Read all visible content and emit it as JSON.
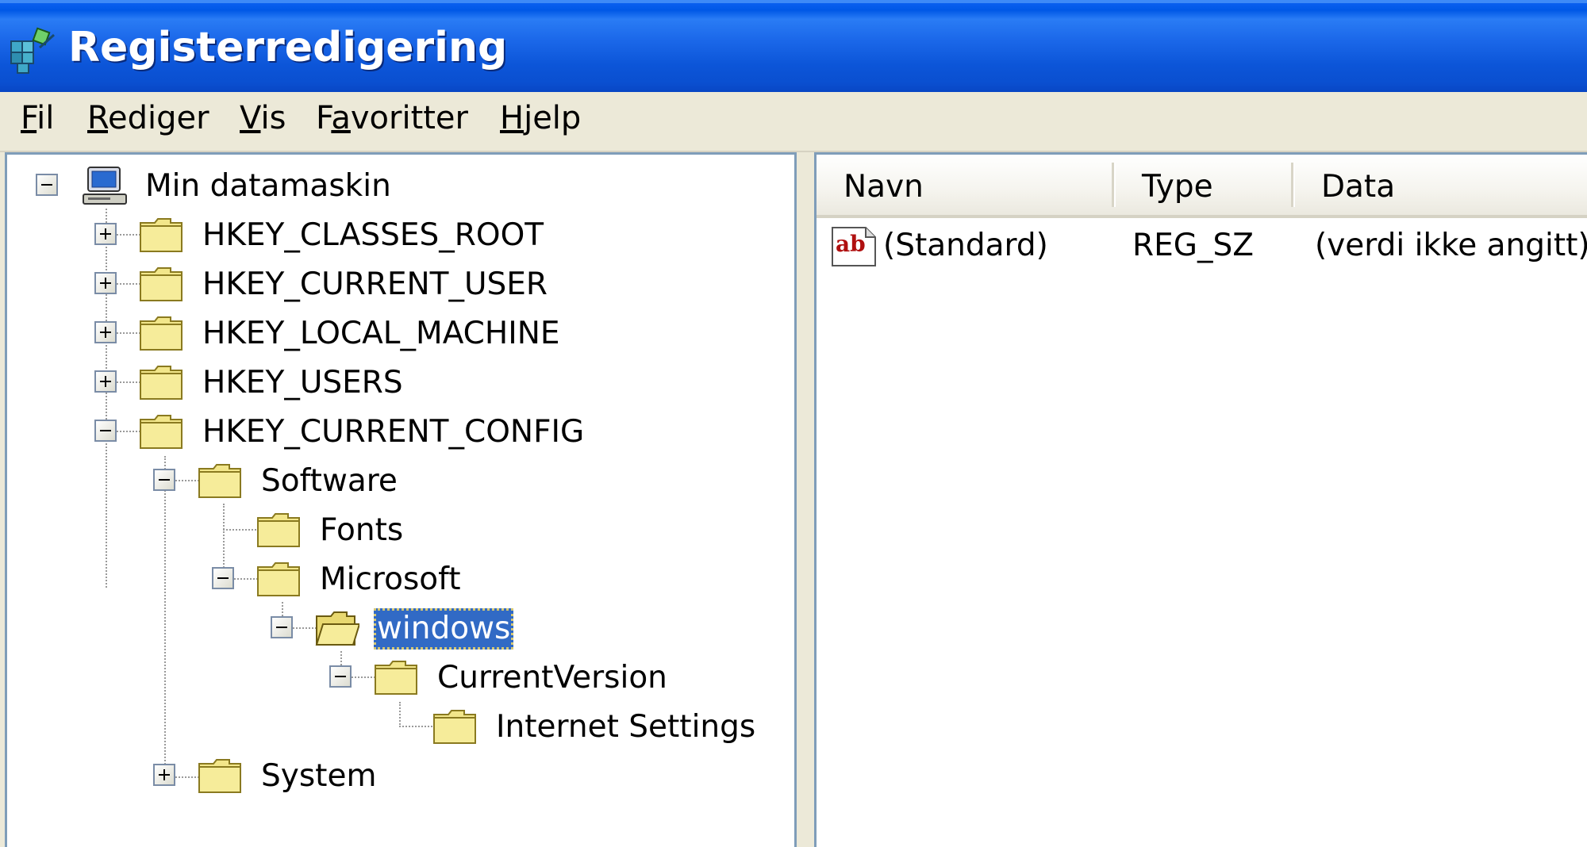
{
  "window": {
    "title": "Registerredigering"
  },
  "menu": [
    {
      "pre": "",
      "u": "F",
      "post": "il"
    },
    {
      "pre": "",
      "u": "R",
      "post": "ediger"
    },
    {
      "pre": "",
      "u": "V",
      "post": "is"
    },
    {
      "pre": "F",
      "u": "a",
      "post": "voritter"
    },
    {
      "pre": "",
      "u": "H",
      "post": "jelp"
    }
  ],
  "tree": {
    "root": "Min datamaskin",
    "hives": [
      "HKEY_CLASSES_ROOT",
      "HKEY_CURRENT_USER",
      "HKEY_LOCAL_MACHINE",
      "HKEY_USERS",
      "HKEY_CURRENT_CONFIG"
    ],
    "software": "Software",
    "fonts": "Fonts",
    "microsoft": "Microsoft",
    "windows": "windows",
    "current_version": "CurrentVersion",
    "internet_settings": "Internet Settings",
    "system": "System"
  },
  "list": {
    "columns": [
      "Navn",
      "Type",
      "Data"
    ],
    "rows": [
      {
        "name": "(Standard)",
        "type": "REG_SZ",
        "data": "(verdi ikke angitt)",
        "icon": "string-value-icon"
      }
    ]
  }
}
